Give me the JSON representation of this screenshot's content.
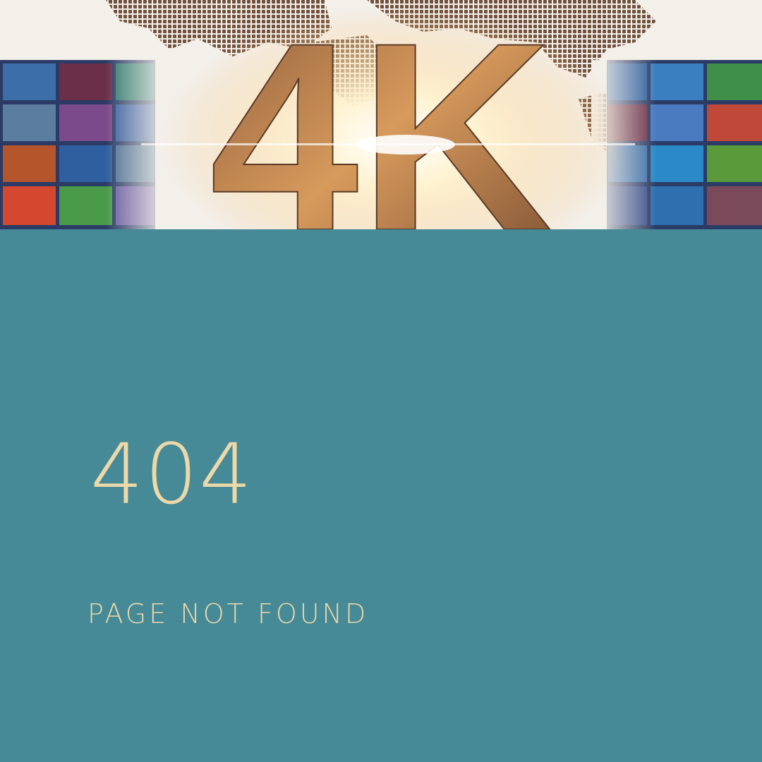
{
  "hero": {
    "graphic_text": "4K",
    "icon": "world-map-4k-banner"
  },
  "error": {
    "code": "404",
    "message": "PAGE NOT FOUND"
  },
  "colors": {
    "panel_background": "#468a97",
    "text": "#ecd8a8",
    "hero_background": "#f3efe9"
  }
}
